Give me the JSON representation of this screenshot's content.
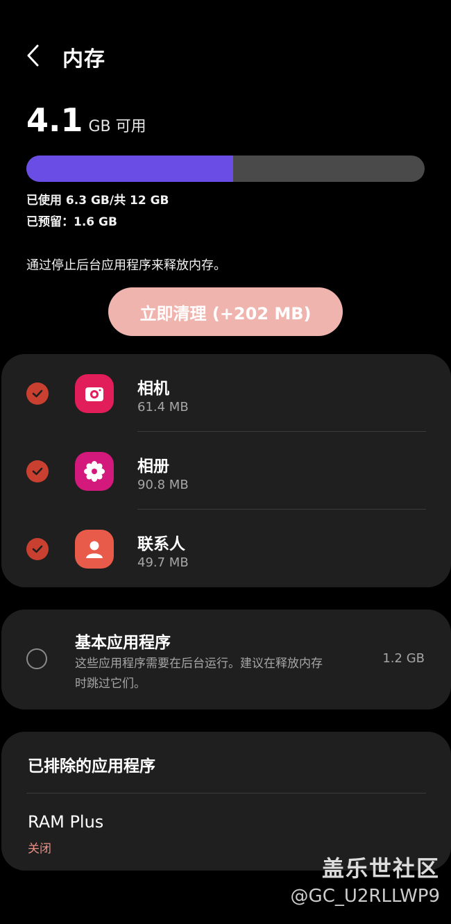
{
  "header": {
    "title": "内存"
  },
  "memory": {
    "available_value": "4.1",
    "available_unit": "GB 可用",
    "used_fraction": 0.52,
    "used_text": "已使用 6.3 GB/共 12 GB",
    "reserved_text": "已预留：1.6 GB",
    "hint": "通过停止后台应用程序来释放内存。",
    "clean_button": "立即清理 (+202 MB)"
  },
  "apps": [
    {
      "name": "相机",
      "size": "61.4 MB",
      "icon": "camera-icon",
      "color": "#e11d5a"
    },
    {
      "name": "相册",
      "size": "90.8 MB",
      "icon": "gallery-flower-icon",
      "color": "#d3197b"
    },
    {
      "name": "联系人",
      "size": "49.7 MB",
      "icon": "contacts-person-icon",
      "color": "#e85a4a"
    }
  ],
  "basic_apps": {
    "title": "基本应用程序",
    "desc_line1": "这些应用程序需要在后台运行。建议在释放内存",
    "desc_line2": "时跳过它们。",
    "size": "1.2 GB"
  },
  "excluded": {
    "title": "已排除的应用程序",
    "ram_plus_title": "RAM Plus",
    "ram_plus_status": "关闭"
  },
  "watermark": {
    "line1": "盖乐世社区",
    "line2": "@GC_U2RLLWP9"
  },
  "colors": {
    "accent_bar": "#6a4de4",
    "check": "#c94030",
    "clean_button": "#f0b4ae",
    "status_off": "#ec8f84"
  }
}
